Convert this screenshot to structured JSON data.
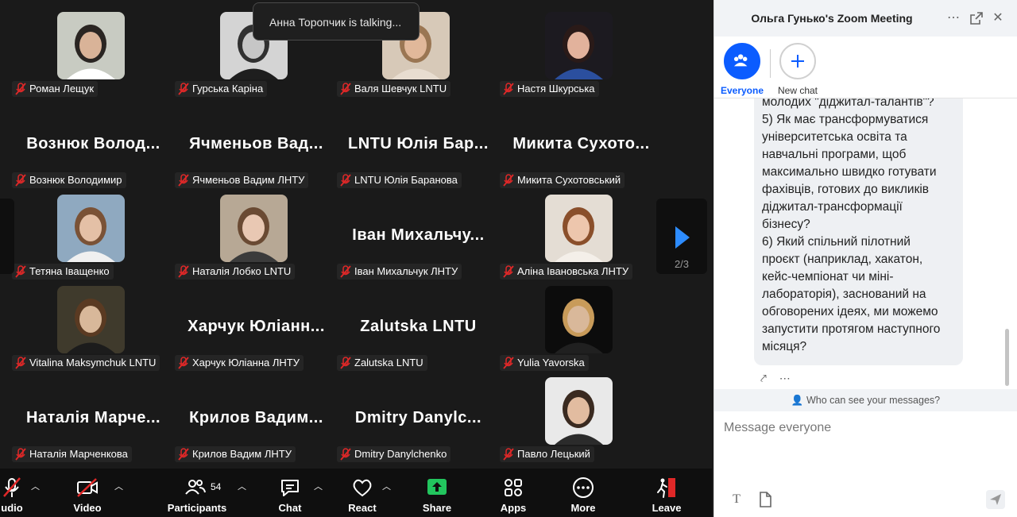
{
  "talking_toast": "Анна Торопчик is talking...",
  "pagination": "2/3",
  "participants": [
    {
      "label": "Роман Лещук",
      "type": "photo",
      "bg": "#c8cbc2",
      "face": "#d9b398",
      "hair": "#2a2522",
      "shirt": "#ffffff"
    },
    {
      "label": "Гурська Каріна",
      "type": "photo",
      "bg": "#d4d4d4",
      "face": "#c6c6c6",
      "hair": "#303030",
      "shirt": "#1e1e1e"
    },
    {
      "label": "Валя Шевчук LNTU",
      "type": "photo",
      "bg": "#d7c9b8",
      "face": "#e1b89a",
      "hair": "#9a7653",
      "shirt": "#e8ddd0"
    },
    {
      "label": "Настя Шкурська",
      "type": "photo",
      "bg": "#1c1a20",
      "face": "#e2b29c",
      "hair": "#2a1a18",
      "shirt": "#2b4f9e"
    },
    {
      "label": "Вознюк Володимир",
      "type": "name",
      "big": "Вознюк Волод..."
    },
    {
      "label": "Ячменьов Вадим ЛНТУ",
      "type": "name",
      "big": "Ячменьов Вад..."
    },
    {
      "label": "LNTU Юлія Баранова",
      "type": "name",
      "big": "LNTU Юлія Бар..."
    },
    {
      "label": "Микита Сухотовський",
      "type": "name",
      "big": "Микита Сухото..."
    },
    {
      "label": "Тетяна Іващенко",
      "type": "photo",
      "bg": "#8fa9c0",
      "face": "#e4c0a6",
      "hair": "#7a5236",
      "shirt": "#f0f0f0"
    },
    {
      "label": "Наталія Лобко LNTU",
      "type": "photo",
      "bg": "#b7a895",
      "face": "#e9c8b3",
      "hair": "#6a4a33",
      "shirt": "#3b3b3b"
    },
    {
      "label": "Іван Михальчук ЛНТУ",
      "type": "name",
      "big": "Іван Михальчу..."
    },
    {
      "label": "Аліна Івановська ЛНТУ",
      "type": "photo",
      "bg": "#e4ddd4",
      "face": "#edc6ad",
      "hair": "#8a4f2b",
      "shirt": "#f4efe9"
    },
    {
      "label": "Vitalina Maksymchuk LNTU",
      "type": "photo",
      "bg": "#3f3a2c",
      "face": "#d8b89a",
      "hair": "#5a3a22",
      "shirt": "#1c1c1c"
    },
    {
      "label": "Харчук Юліанна ЛНТУ",
      "type": "name",
      "big": "Харчук Юліанн..."
    },
    {
      "label": "Zalutska LNTU",
      "type": "name",
      "big": "Zalutska LNTU"
    },
    {
      "label": "Yulia Yavorska",
      "type": "photo",
      "bg": "#0c0c0c",
      "face": "#d9b89a",
      "hair": "#c89b5a",
      "shirt": "#202020"
    },
    {
      "label": "Наталія Марченкова",
      "type": "name",
      "big": "Наталія Марче..."
    },
    {
      "label": "Крилов Вадим ЛНТУ",
      "type": "name",
      "big": "Крилов Вадим..."
    },
    {
      "label": "Dmitry Danylchenko",
      "type": "name",
      "big": "Dmitry Danylc..."
    },
    {
      "label": "Павло Лецький",
      "type": "photo",
      "bg": "#e9e9e9",
      "face": "#e2bca0",
      "hair": "#3a2a20",
      "shirt": "#2b2b2b"
    }
  ],
  "toolbar": {
    "audio": "udio",
    "video": "Video",
    "participants": "Participants",
    "participants_count": "54",
    "chat": "Chat",
    "react": "React",
    "share": "Share",
    "apps": "Apps",
    "more": "More",
    "leave": "Leave"
  },
  "chat": {
    "title": "Ольга Гунько's Zoom Meeting",
    "tab_everyone": "Everyone",
    "tab_new_chat": "New chat",
    "message_lines": [
      "молодих \"діджитал-талантів\"?",
      "5) Як має трансформуватися",
      "університетська освіта та",
      "навчальні програми, щоб",
      "максимально швидко готувати",
      "фахівців, готових до викликів",
      "діджитал-трансформації",
      "бізнесу?",
      "6) Який спільний пілотний",
      "проєкт (наприклад, хакатон,",
      "кейс-чемпіонат чи міні-",
      "лабораторія), заснований на",
      "обговорених ідеях, ми можемо",
      "запустити протягом наступного",
      "місяця?"
    ],
    "who_can_see": "Who can see your messages?",
    "input_placeholder": "Message everyone"
  },
  "colors": {
    "accent": "#0b5cff",
    "share_green": "#22c55e",
    "leave_red": "#e02828",
    "mute_red": "#e02828"
  }
}
